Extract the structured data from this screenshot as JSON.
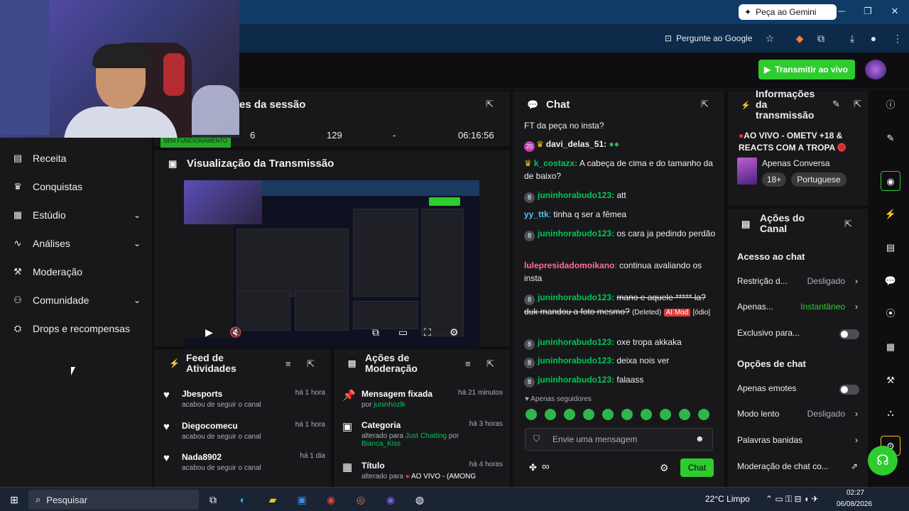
{
  "browser": {
    "gemini_label": "Peça ao Gemini",
    "google_label": "Pergunte ao Google"
  },
  "topnav": {
    "live_button": "Transmitir ao vivo"
  },
  "sidebar": {
    "items": [
      {
        "label": "Receita",
        "icon": "receipt-icon"
      },
      {
        "label": "Conquistas",
        "icon": "trophy-icon"
      },
      {
        "label": "Estúdio",
        "icon": "studio-icon",
        "expandable": true
      },
      {
        "label": "Análises",
        "icon": "analytics-icon",
        "expandable": true
      },
      {
        "label": "Moderação",
        "icon": "wrench-icon"
      },
      {
        "label": "Comunidade",
        "icon": "community-icon",
        "expandable": true
      },
      {
        "label": "Drops e recompensas",
        "icon": "drops-icon"
      }
    ]
  },
  "session": {
    "title": "es da sessão",
    "stats": [
      "6",
      "129",
      "-",
      "06:16:56"
    ],
    "strip_text": "SEM FUNCIONAMENTO"
  },
  "preview": {
    "title": "Visualização da Transmissão"
  },
  "feed": {
    "title_line1": "Feed de",
    "title_line2": "Atividades",
    "items": [
      {
        "name": "Jbesports",
        "time": "há 1 hora",
        "sub": "acabou de seguir o canal"
      },
      {
        "name": "Diegocomecu",
        "time": "há 1 hora",
        "sub": "acabou de seguir o canal"
      },
      {
        "name": "Nada8902",
        "time": "há 1 dia",
        "sub": "acabou de seguir o canal"
      }
    ]
  },
  "moderation": {
    "title_line1": "Ações de",
    "title_line2": "Moderação",
    "items": [
      {
        "name": "Mensagem fixada",
        "time": "há 21 minutos",
        "sub_pre": "por ",
        "sub_hl": "juninhozlk",
        "sub_mid": "",
        "sub_hl2": ""
      },
      {
        "name": "Categoria",
        "time": "há 3 horas",
        "sub_pre": "alterado para ",
        "sub_hl": "Just Chatting",
        "sub_mid": " por",
        "sub_hl2": "Bianca_Kiss"
      },
      {
        "name": "Título",
        "time": "há 4 horas",
        "sub_pre": "alterado para ",
        "sub_hl": "",
        "sub_mid": "AO VIVO - (AMONG",
        "sub_hl2": ""
      }
    ]
  },
  "chat": {
    "title": "Chat",
    "lines": [
      {
        "text": "FT da peça no insta?"
      },
      {
        "badge": "20",
        "crown": true,
        "user": "davi_delas_51",
        "color": "#efeff1",
        "text": ""
      },
      {
        "crown": true,
        "user": "k_costazx",
        "color": "#00c853",
        "text": "A cabeça de cima e do tamanho da de baixo?"
      },
      {
        "badge": "8",
        "user": "juninhorabudo123",
        "color": "#00c853",
        "text": "att"
      },
      {
        "user": "yy_ttk",
        "color": "#4fc3f7",
        "text": "tinha q ser a fêmea"
      },
      {
        "badge": "8",
        "user": "juninhorabudo123",
        "color": "#00c853",
        "text": "os cara ja pedindo perdão"
      },
      {
        "user": "lulepresidadomoikano",
        "color": "#ff6f91",
        "text": "continua avaliando os insta"
      },
      {
        "badge": "8",
        "user": "juninhorabudo123",
        "color": "#00c853",
        "text": "mano e aquele ***** la? duk mandou a foto mesmo?",
        "deleted": "(Deleted)",
        "aimod": "AI Mod",
        "reason": "[ódio]"
      },
      {
        "badge": "8",
        "user": "juninhorabudo123",
        "color": "#00c853",
        "text": "oxe tropa akkaka"
      },
      {
        "badge": "8",
        "user": "juninhorabudo123",
        "color": "#00c853",
        "text": "deixa nois ver"
      },
      {
        "badge": "8",
        "user": "juninhorabudo123",
        "color": "#00c853",
        "text": "falaass"
      }
    ],
    "followers_only": "Apenas seguidores",
    "input_placeholder": "Envie uma mensagem",
    "send_label": "Chat",
    "infinity": "∞"
  },
  "info": {
    "title_line1": "Informações",
    "title_line2": "da",
    "title_line3": "transmissão",
    "stream_title": "AO VIVO - OMETV +18 & REACTS COM A TROPA",
    "category": "Apenas Conversa",
    "tags": [
      "18+",
      "Portuguese"
    ]
  },
  "actions": {
    "title_line1": "Ações do",
    "title_line2": "Canal",
    "chat_access": "Acesso ao chat",
    "restriction_label": "Restrição d...",
    "restriction_value": "Desligado",
    "apenas_label": "Apenas...",
    "apenas_value": "Instantâneo",
    "exclusive_label": "Exclusivo para...",
    "chat_options": "Opções de chat",
    "emotes_only": "Apenas emotes",
    "slow_mode": "Modo lento",
    "slow_value": "Desligado",
    "banned_words": "Palavras banidas",
    "chat_mod": "Moderação de chat co..."
  },
  "taskbar": {
    "search": "Pesquisar",
    "weather": "22°C Limpo",
    "time": "02:27",
    "date": "06/08/2026"
  },
  "colors": {
    "accent_green": "#2ecc2e",
    "bg": "#0e0e10",
    "panel": "#18181b"
  }
}
